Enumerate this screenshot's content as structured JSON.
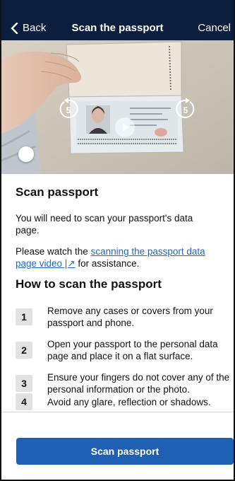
{
  "navbar": {
    "back_label": "Back",
    "title": "Scan the passport",
    "cancel_label": "Cancel"
  },
  "video": {
    "rewind_seconds": "5",
    "forward_seconds": "5",
    "play_icon": "play-icon",
    "progress": 0.0
  },
  "content": {
    "heading": "Scan passport",
    "intro": "You will need to scan your passport's data page.",
    "watch_prefix": "Please watch the ",
    "watch_link": "scanning the passport data page video |↗",
    "watch_suffix": " for assistance.",
    "how_heading": "How to scan the passport",
    "steps": [
      {
        "number": "1",
        "text": "Remove any cases or covers from your passport and phone."
      },
      {
        "number": "2",
        "text": "Open your passport to the personal data page and place it on a flat surface."
      },
      {
        "number": "3",
        "text": "Ensure your fingers do not cover any of the personal information or the photo."
      },
      {
        "number": "4",
        "text": "Avoid any glare, reflection or shadows."
      }
    ]
  },
  "footer": {
    "scan_button_label": "Scan passport"
  },
  "colors": {
    "navbar": "#0b1e3d",
    "link": "#1d66c4",
    "primary_button": "#1f5fb4",
    "step_badge": "#e2e2e2"
  }
}
